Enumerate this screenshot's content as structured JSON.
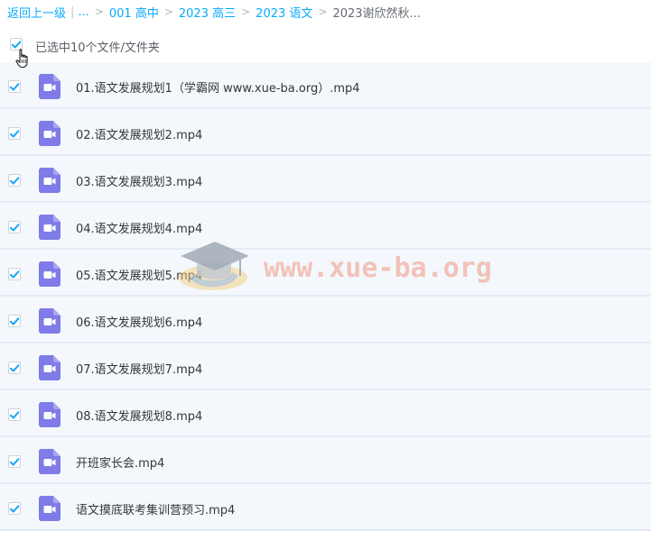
{
  "breadcrumb": {
    "back": "返回上一级",
    "ellipsis": "...",
    "items": [
      "001 高中",
      "2023 高三",
      "2023 语文"
    ],
    "current": "2023谢欣然秋..."
  },
  "selection": {
    "label": "已选中10个文件/文件夹",
    "checked": true
  },
  "files": [
    {
      "name": "01.语文发展规划1（学霸网 www.xue-ba.org）.mp4",
      "checked": true,
      "icon": "video-file-icon"
    },
    {
      "name": "02.语文发展规划2.mp4",
      "checked": true,
      "icon": "video-file-icon"
    },
    {
      "name": "03.语文发展规划3.mp4",
      "checked": true,
      "icon": "video-file-icon"
    },
    {
      "name": "04.语文发展规划4.mp4",
      "checked": true,
      "icon": "video-file-icon"
    },
    {
      "name": "05.语文发展规划5.mp4",
      "checked": true,
      "icon": "video-file-icon"
    },
    {
      "name": "06.语文发展规划6.mp4",
      "checked": true,
      "icon": "video-file-icon"
    },
    {
      "name": "07.语文发展规划7.mp4",
      "checked": true,
      "icon": "video-file-icon"
    },
    {
      "name": "08.语文发展规划8.mp4",
      "checked": true,
      "icon": "video-file-icon"
    },
    {
      "name": "开班家长会.mp4",
      "checked": true,
      "icon": "video-file-icon"
    },
    {
      "name": "语文摸底联考集训营预习.mp4",
      "checked": true,
      "icon": "video-file-icon"
    }
  ],
  "watermark": {
    "text": "www.xue-ba.org"
  },
  "colors": {
    "link": "#09AAFF",
    "check": "#1AA8F5",
    "file_icon": "#7F7BE8",
    "row_bg": "#F4F8FC",
    "row_border": "#E2ECF6"
  }
}
